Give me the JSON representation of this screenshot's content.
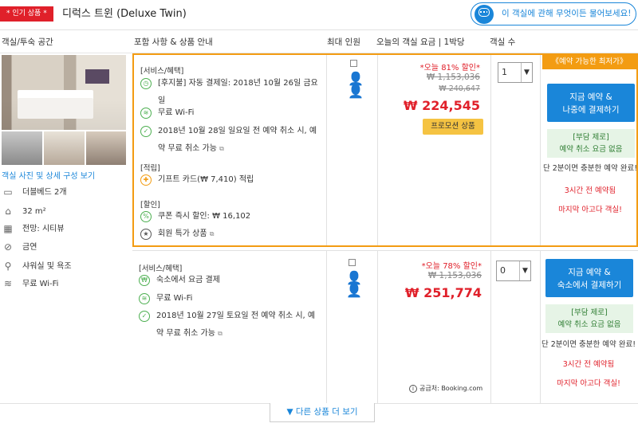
{
  "header": {
    "badge": "* 인기 상품 *",
    "room_title": "디럭스 트윈 (Deluxe Twin)",
    "chat_text": "이 객실에 관해 무엇이든 물어보세요!"
  },
  "columns": {
    "room": "객실/투숙 공간",
    "includes": "포함 사항 & 상품 안내",
    "max_guests": "최대 인원",
    "price": "오늘의 객실 요금 | 1박당",
    "rooms": "객실 수"
  },
  "room_info": {
    "photos_link": "객실 사진 및 상세 구성 보기",
    "amenities": [
      {
        "icon": "bed-icon",
        "label": "더블베드 2개"
      },
      {
        "icon": "area-icon",
        "label": "32 m²"
      },
      {
        "icon": "view-icon",
        "label": "전망: 시티뷰"
      },
      {
        "icon": "no-smoking-icon",
        "label": "금연"
      },
      {
        "icon": "shower-icon",
        "label": "샤워실 및 욕조"
      },
      {
        "icon": "wifi-icon",
        "label": "무료 Wi-Fi"
      }
    ]
  },
  "offers": [
    {
      "services_label": "[서비스/혜택]",
      "features": [
        "[후지불] 자동 결제일: 2018년 10월 26일 금요일",
        "무료 Wi-Fi",
        "2018년 10월 28일 일요일 전 예약 취소 시, 예약 무료 취소 가능"
      ],
      "points_label": "[적립]",
      "points": "기프트 카드(₩ 7,410) 적립",
      "discount_label": "[할인]",
      "discounts": [
        "쿠폰 즉시 할인: ₩ 16,102",
        "회원 특가 상품"
      ],
      "discount_pct": "*오늘 81% 할인*",
      "original_price": "₩ 1,153,036",
      "original_price2": "₩ 240,647",
      "price": "₩ 224,545",
      "promo": "프로모션 상품",
      "qty": "1",
      "best_label": "《예약 가능한 최저가》",
      "book_line1": "지금 예약 &",
      "book_line2": "나중에 결제하기",
      "nocharge_line1": "[부담 제로]",
      "nocharge_line2": "예약 취소 요금 없음",
      "note1": "단 2분이면 충분한 예약 완료!",
      "note2": "3시간 전 예약됨",
      "note3": "마지막 아고다 객실!"
    },
    {
      "services_label": "[서비스/혜택]",
      "features": [
        "숙소에서 요금 결제",
        "무료 Wi-Fi",
        "2018년 10월 27일 토요일 전 예약 취소 시, 예약 무료 취소 가능"
      ],
      "discount_pct": "*오늘 78% 할인*",
      "original_price": "₩ 1,153,036",
      "price": "₩ 251,774",
      "source": "공급처: Booking.com",
      "qty": "0",
      "book_line1": "지금 예약 &",
      "book_line2": "숙소에서 결제하기",
      "nocharge_line1": "[부담 제로]",
      "nocharge_line2": "예약 취소 요금 없음",
      "note1": "단 2분이면 충분한 예약 완료!",
      "note2": "3시간 전 예약됨",
      "note3": "마지막 아고다 객실!"
    }
  ],
  "more_button": "▼ 다른 상품 더 보기"
}
